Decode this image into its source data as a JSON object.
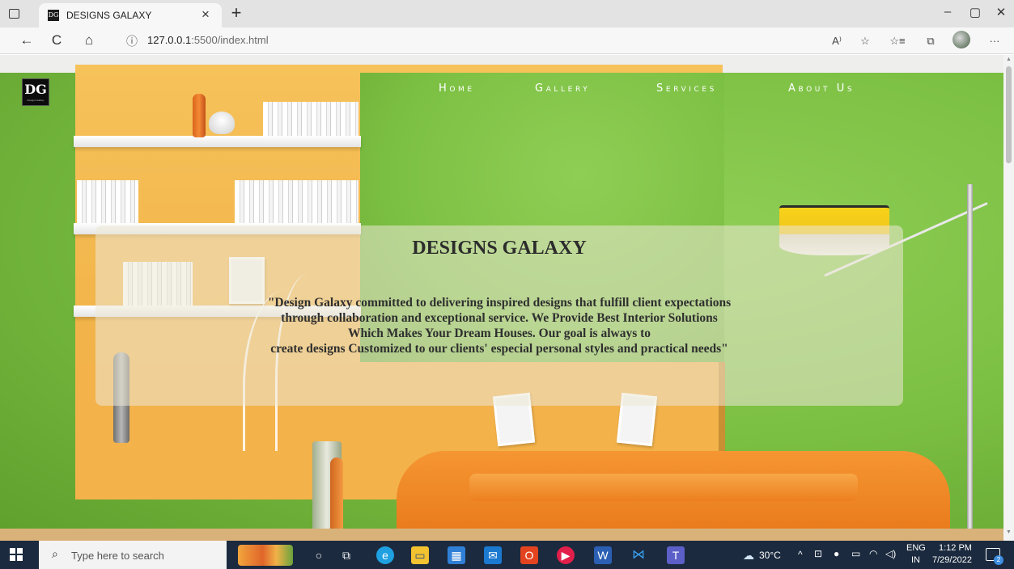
{
  "browser": {
    "tab_title": "DESIGNS GALAXY",
    "tab_favicon": "DG",
    "tab_close_glyph": "×",
    "new_tab_glyph": "+",
    "window_controls": [
      "–",
      "▢",
      "✕"
    ],
    "nav": {
      "back": "←",
      "refresh": "C",
      "home": "⌂"
    },
    "address": {
      "info_glyph": "ⓘ",
      "host": "127.0.0.1",
      "path": ":5500/index.html"
    },
    "toolbar": {
      "read_aloud": "A⁾",
      "favorite": "☆",
      "favorites_list": "☆≡",
      "collections": "⧉",
      "more": "···"
    }
  },
  "page": {
    "logo": {
      "mark": "DG",
      "tagline": "Designs Galaxy"
    },
    "menu": [
      {
        "label": "Home"
      },
      {
        "label": "Gallery"
      },
      {
        "label": "Services"
      },
      {
        "label": "About Us"
      }
    ],
    "hero": {
      "title": "DESIGNS GALAXY",
      "lines": [
        "\"Design Galaxy committed to delivering inspired designs that fulfill client expectations",
        "through collaboration and exceptional service. We Provide Best Interior Solutions",
        "Which Makes Your Dream Houses. Our goal is always to",
        "create designs Customized to our clients' especial personal styles and practical needs\""
      ]
    }
  },
  "taskbar": {
    "search_placeholder": "Type here to search",
    "apps": [
      {
        "icon": "cortana-circle-icon",
        "glyph": "○"
      },
      {
        "icon": "task-view-icon",
        "glyph": "⧉"
      },
      {
        "icon": "edge-icon",
        "glyph": "e"
      },
      {
        "icon": "file-explorer-icon",
        "glyph": "▭"
      },
      {
        "icon": "store-icon",
        "glyph": "▦"
      },
      {
        "icon": "mail-icon",
        "glyph": "✉"
      },
      {
        "icon": "office-icon",
        "glyph": "O"
      },
      {
        "icon": "media-player-icon",
        "glyph": "▶"
      },
      {
        "icon": "word-icon",
        "glyph": "W"
      },
      {
        "icon": "vscode-icon",
        "glyph": "⋈"
      },
      {
        "icon": "teams-icon",
        "glyph": "T"
      }
    ],
    "weather": "30°C",
    "tray_chevron": "^",
    "language": "ENG",
    "region": "IN",
    "time": "1:12 PM",
    "date": "7/29/2022",
    "notifications": "2"
  },
  "colors": {
    "wall_green": "#7cc043",
    "niche_yellow": "#f2b44a",
    "sofa_orange": "#f08a2a",
    "hero_panel": "#ece8d6",
    "taskbar": "#1b2a3e"
  }
}
